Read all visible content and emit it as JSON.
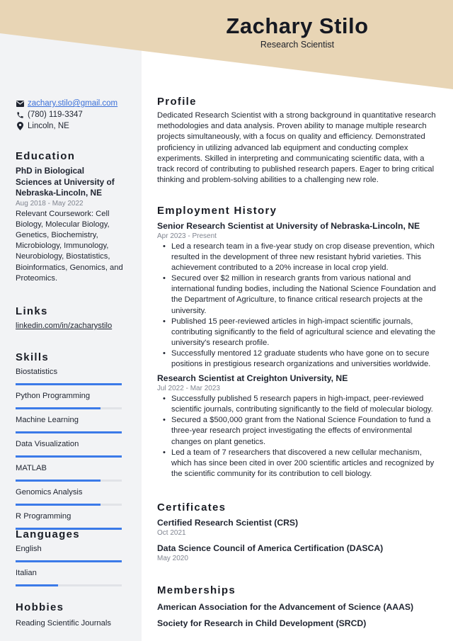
{
  "colors": {
    "banner": "#e8d5b5",
    "sidebar": "#f2f3f5",
    "accent": "#3b7ae8",
    "link": "#3a6fd8"
  },
  "header": {
    "name": "Zachary Stilo",
    "role": "Research Scientist"
  },
  "contact": {
    "email": {
      "icon": "envelope-icon",
      "text": "zachary.stilo@gmail.com"
    },
    "phone": {
      "icon": "phone-icon",
      "text": "(780) 119-3347"
    },
    "location": {
      "icon": "map-pin-icon",
      "text": "Lincoln, NE"
    }
  },
  "education": {
    "title": "Education",
    "degree_line1": "PhD in Biological",
    "degree_line2": "Sciences at University of",
    "degree_line3": "Nebraska-Lincoln, NE",
    "dates": "Aug 2018 - May 2022",
    "coursework": "Relevant Coursework: Cell Biology, Molecular Biology, Genetics, Biochemistry, Microbiology, Immunology, Neurobiology, Biostatistics, Bioinformatics, Genomics, and Proteomics."
  },
  "links": {
    "title": "Links",
    "items": [
      "linkedin.com/in/zacharystilo"
    ]
  },
  "skills": {
    "title": "Skills",
    "items": [
      {
        "label": "Biostatistics",
        "level": 1.0
      },
      {
        "label": "Python Programming",
        "level": 0.8
      },
      {
        "label": "Machine Learning",
        "level": 1.0
      },
      {
        "label": "Data Visualization",
        "level": 1.0
      },
      {
        "label": "MATLAB",
        "level": 0.8
      },
      {
        "label": "Genomics Analysis",
        "level": 0.8
      },
      {
        "label": "R Programming",
        "level": 1.0
      }
    ]
  },
  "languages": {
    "title": "Languages",
    "items": [
      {
        "label": "English",
        "level": 1.0
      },
      {
        "label": "Italian",
        "level": 0.4
      }
    ]
  },
  "hobbies": {
    "title": "Hobbies",
    "items": [
      "Reading Scientific Journals"
    ]
  },
  "profile": {
    "title": "Profile",
    "text": "Dedicated Research Scientist with a strong background in quantitative research methodologies and data analysis. Proven ability to manage multiple research projects simultaneously, with a focus on quality and efficiency. Demonstrated proficiency in utilizing advanced lab equipment and conducting complex experiments. Skilled in interpreting and communicating scientific data, with a track record of contributing to published research papers. Eager to bring critical thinking and problem-solving abilities to a challenging new role."
  },
  "employment": {
    "title": "Employment History",
    "jobs": [
      {
        "title": "Senior Research Scientist at University of Nebraska-Lincoln, NE",
        "dates": "Apr 2023 - Present",
        "bullets": [
          "Led a research team in a five-year study on crop disease prevention, which resulted in the development of three new resistant hybrid varieties. This achievement contributed to a 20% increase in local crop yield.",
          "Secured over $2 million in research grants from various national and international funding bodies, including the National Science Foundation and the Department of Agriculture, to finance critical research projects at the university.",
          "Published 15 peer-reviewed articles in high-impact scientific journals, contributing significantly to the field of agricultural science and elevating the university's research profile.",
          "Successfully mentored 12 graduate students who have gone on to secure positions in prestigious research organizations and universities worldwide."
        ]
      },
      {
        "title": "Research Scientist at Creighton University, NE",
        "dates": "Jul 2022 - Mar 2023",
        "bullets": [
          "Successfully published 5 research papers in high-impact, peer-reviewed scientific journals, contributing significantly to the field of molecular biology.",
          "Secured a $500,000 grant from the National Science Foundation to fund a three-year research project investigating the effects of environmental changes on plant genetics.",
          "Led a team of 7 researchers that discovered a new cellular mechanism, which has since been cited in over 200 scientific articles and recognized by the scientific community for its contribution to cell biology."
        ]
      }
    ]
  },
  "certificates": {
    "title": "Certificates",
    "items": [
      {
        "name": "Certified Research Scientist (CRS)",
        "date": "Oct 2021"
      },
      {
        "name": "Data Science Council of America Certification (DASCA)",
        "date": "May 2020"
      }
    ]
  },
  "memberships": {
    "title": "Memberships",
    "items": [
      "American Association for the Advancement of Science (AAAS)",
      "Society for Research in Child Development (SRCD)"
    ]
  }
}
